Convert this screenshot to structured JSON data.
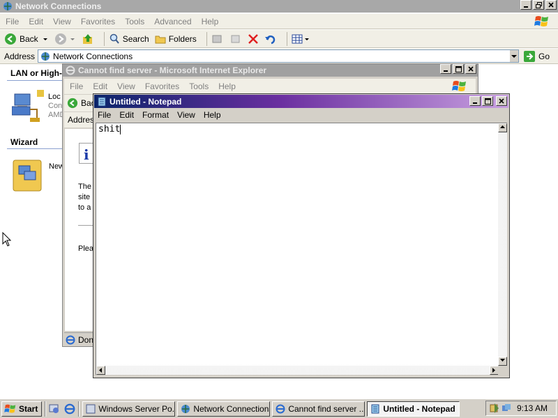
{
  "network_connections": {
    "title": "Network Connections",
    "menu": [
      "File",
      "Edit",
      "View",
      "Favorites",
      "Tools",
      "Advanced",
      "Help"
    ],
    "toolbar": {
      "back": "Back",
      "search": "Search",
      "folders": "Folders"
    },
    "address": {
      "label": "Address",
      "value": "Network Connections",
      "go": "Go"
    },
    "sections": {
      "lan_heading": "LAN or High-S",
      "lan_item": {
        "name": "Loc",
        "line2": "Con",
        "line3": "AMD"
      },
      "wizard_heading": "Wizard",
      "wizard_item": "New"
    }
  },
  "ie": {
    "title": "Cannot find server - Microsoft Internet Explorer",
    "menu": [
      "File",
      "Edit",
      "View",
      "Favorites",
      "Tools",
      "Help"
    ],
    "back": "Bac",
    "address_label": "Addres",
    "page_lines": [
      "The",
      "site",
      "to a"
    ],
    "please": "Plea",
    "status": "Don"
  },
  "notepad": {
    "title": "Untitled - Notepad",
    "menu": [
      "File",
      "Edit",
      "Format",
      "View",
      "Help"
    ],
    "text": "shit"
  },
  "taskbar": {
    "start": "Start",
    "tasks": [
      "Windows Server Po...",
      "Network Connections",
      "Cannot find server ...",
      "Untitled - Notepad"
    ],
    "clock": "9:13 AM"
  }
}
